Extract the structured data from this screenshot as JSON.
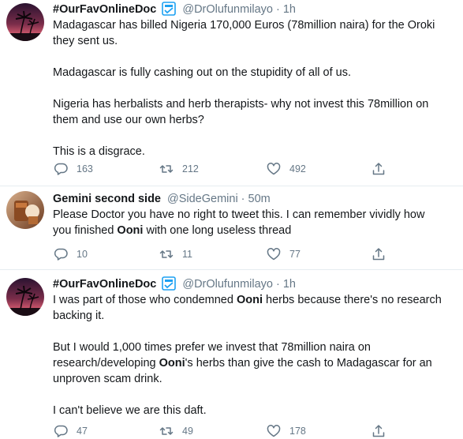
{
  "tweets": [
    {
      "name": "#OurFavOnlineDoc",
      "handle": "@DrOlufunmilayo",
      "dot": "·",
      "time": "1h",
      "paragraphs": [
        {
          "lines": [
            [
              {
                "t": "Madagascar has billed Nigeria 170,000 Euros (78million naira) for the Oroki"
              }
            ],
            [
              {
                "t": "they sent us."
              }
            ]
          ]
        },
        {
          "lines": [
            [
              {
                "t": "Madagascar is fully cashing out on the stupidity of all of us."
              }
            ]
          ]
        },
        {
          "lines": [
            [
              {
                "t": "Nigeria has herbalists and herb therapists- why not invest this 78million on"
              }
            ],
            [
              {
                "t": "them and use our own herbs?"
              }
            ]
          ]
        },
        {
          "lines": [
            [
              {
                "t": "This is a disgrace."
              }
            ]
          ]
        }
      ],
      "reply_count": "163",
      "retweet_count": "212",
      "like_count": "492"
    },
    {
      "name": "Gemini second side",
      "handle": "@SideGemini",
      "dot": "·",
      "time": "50m",
      "paragraphs": [
        {
          "lines": [
            [
              {
                "t": "Please Doctor you have no right to tweet this. I can remember vividly how"
              }
            ],
            [
              {
                "t": "you finished "
              },
              {
                "t": "Ooni",
                "b": true
              },
              {
                "t": " with one long useless thread"
              }
            ]
          ]
        }
      ],
      "reply_count": "10",
      "retweet_count": "11",
      "like_count": "77"
    },
    {
      "name": "#OurFavOnlineDoc",
      "handle": "@DrOlufunmilayo",
      "dot": "·",
      "time": "1h",
      "paragraphs": [
        {
          "lines": [
            [
              {
                "t": "I was part of those who condemned "
              },
              {
                "t": "Ooni",
                "b": true
              },
              {
                "t": " herbs because there's no research"
              }
            ],
            [
              {
                "t": "backing it."
              }
            ]
          ]
        },
        {
          "lines": [
            [
              {
                "t": "But I would 1,000 times prefer we invest that 78million naira on"
              }
            ],
            [
              {
                "t": "research/developing "
              },
              {
                "t": "Ooni",
                "b": true
              },
              {
                "t": "'s herbs than give the cash to Madagascar for an"
              }
            ],
            [
              {
                "t": "unproven scam drink."
              }
            ]
          ]
        },
        {
          "lines": [
            [
              {
                "t": "I can't believe we are this daft."
              }
            ]
          ]
        }
      ],
      "reply_count": "47",
      "retweet_count": "49",
      "like_count": "178"
    }
  ],
  "colors": {
    "text": "#14171a",
    "secondary": "#657786",
    "divider": "#e6ecf0",
    "verified_blue": "#1da1f2"
  },
  "icons": {
    "reply": "reply-icon",
    "retweet": "retweet-icon",
    "like": "like-icon",
    "share": "share-icon",
    "verified": "verified-icon"
  }
}
